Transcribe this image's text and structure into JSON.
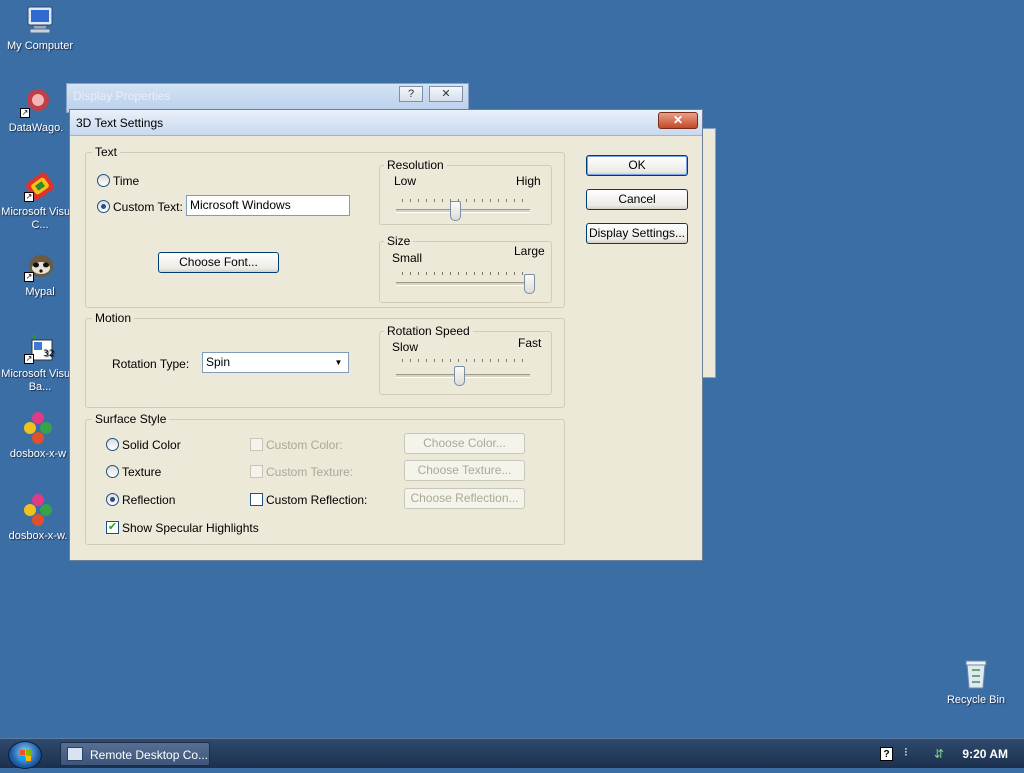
{
  "desktop": {
    "icons": [
      {
        "label": "My Computer",
        "icon": "computer-icon"
      },
      {
        "label": "DataWago.",
        "icon": "datawago-icon"
      },
      {
        "label": "Microsoft Visual C...",
        "icon": "visual-c-icon"
      },
      {
        "label": "Mypal",
        "icon": "mypal-icon"
      },
      {
        "label": "Microsoft Visual Ba...",
        "icon": "visual-basic-icon"
      },
      {
        "label": "dosbox-x-w",
        "icon": "dosbox-icon"
      },
      {
        "label": "dosbox-x-w.",
        "icon": "dosbox-icon"
      },
      {
        "label": "Recycle Bin",
        "icon": "recycle-bin-icon"
      }
    ],
    "background_color": "#3a6ea5"
  },
  "background_window": {
    "title": "Display Properties",
    "help_label": "?",
    "close_label": "✕"
  },
  "dialog": {
    "title": "3D Text Settings",
    "close_label": "✕",
    "text_group": {
      "label": "Text",
      "time_label": "Time",
      "custom_text_label": "Custom Text:",
      "custom_text_value": "Microsoft Windows",
      "choose_font_label": "Choose Font...",
      "selected": "custom_text"
    },
    "resolution": {
      "label": "Resolution",
      "low_label": "Low",
      "high_label": "High",
      "value": 0.45
    },
    "size": {
      "label": "Size",
      "small_label": "Small",
      "large_label": "Large",
      "value": 1.0
    },
    "motion_group": {
      "label": "Motion",
      "rotation_type_label": "Rotation Type:",
      "rotation_type_value": "Spin"
    },
    "rotation_speed": {
      "label": "Rotation Speed",
      "slow_label": "Slow",
      "fast_label": "Fast",
      "value": 0.48
    },
    "surface_group": {
      "label": "Surface Style",
      "solid_color_label": "Solid Color",
      "texture_label": "Texture",
      "reflection_label": "Reflection",
      "specular_label": "Show Specular Highlights",
      "specular_checked": true,
      "custom_color_label": "Custom Color:",
      "custom_texture_label": "Custom Texture:",
      "custom_reflection_label": "Custom Reflection:",
      "choose_color_label": "Choose Color...",
      "choose_texture_label": "Choose Texture...",
      "choose_reflection_label": "Choose Reflection...",
      "selected": "reflection"
    },
    "buttons": {
      "ok": "OK",
      "cancel": "Cancel",
      "display_settings": "Display Settings..."
    }
  },
  "taskbar": {
    "task_label": "Remote Desktop Co...",
    "clock": "9:20 AM",
    "help_glyph": "?"
  }
}
